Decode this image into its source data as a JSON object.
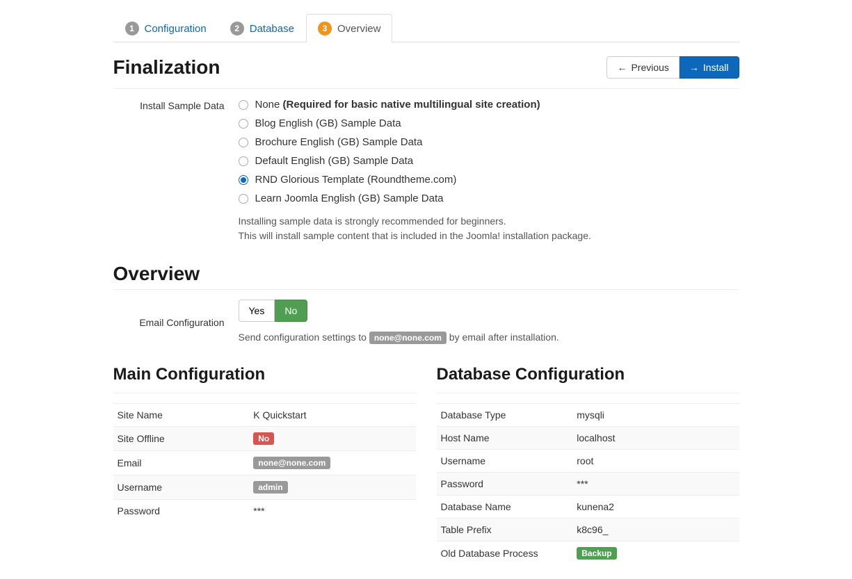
{
  "tabs": [
    {
      "num": "1",
      "label": "Configuration"
    },
    {
      "num": "2",
      "label": "Database"
    },
    {
      "num": "3",
      "label": "Overview"
    }
  ],
  "finalization": {
    "title": "Finalization",
    "previous": "Previous",
    "install": "Install"
  },
  "sample_data": {
    "label": "Install Sample Data",
    "options": [
      {
        "text_prefix": "None ",
        "text_bold": "(Required for basic native multilingual site creation)",
        "checked": false
      },
      {
        "text": "Blog English (GB) Sample Data",
        "checked": false
      },
      {
        "text": "Brochure English (GB) Sample Data",
        "checked": false
      },
      {
        "text": "Default English (GB) Sample Data",
        "checked": false
      },
      {
        "text": "RND Glorious Template (Roundtheme.com)",
        "checked": true
      },
      {
        "text": "Learn Joomla English (GB) Sample Data",
        "checked": false
      }
    ],
    "help1": "Installing sample data is strongly recommended for beginners.",
    "help2": "This will install sample content that is included in the Joomla! installation package."
  },
  "overview": {
    "title": "Overview",
    "email_label": "Email Configuration",
    "yes": "Yes",
    "no": "No",
    "email_text_before": "Send configuration settings to ",
    "email_address": "none@none.com",
    "email_text_after": " by email after installation."
  },
  "main_config": {
    "title": "Main Configuration",
    "rows": [
      {
        "k": "Site Name",
        "v": "K Quickstart",
        "type": "text"
      },
      {
        "k": "Site Offline",
        "v": "No",
        "type": "badge-red"
      },
      {
        "k": "Email",
        "v": "none@none.com",
        "type": "badge-gray"
      },
      {
        "k": "Username",
        "v": "admin",
        "type": "badge-gray"
      },
      {
        "k": "Password",
        "v": "***",
        "type": "text"
      }
    ]
  },
  "db_config": {
    "title": "Database Configuration",
    "rows": [
      {
        "k": "Database Type",
        "v": "mysqli",
        "type": "text"
      },
      {
        "k": "Host Name",
        "v": "localhost",
        "type": "text"
      },
      {
        "k": "Username",
        "v": "root",
        "type": "text"
      },
      {
        "k": "Password",
        "v": "***",
        "type": "text"
      },
      {
        "k": "Database Name",
        "v": "kunena2",
        "type": "text"
      },
      {
        "k": "Table Prefix",
        "v": "k8c96_",
        "type": "text"
      },
      {
        "k": "Old Database Process",
        "v": "Backup",
        "type": "badge-green"
      }
    ]
  }
}
